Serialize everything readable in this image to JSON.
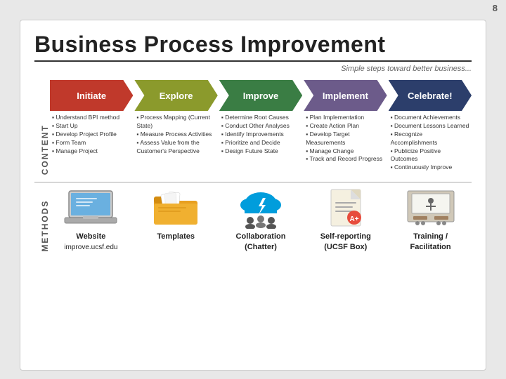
{
  "page": {
    "number": "8"
  },
  "header": {
    "title": "Business Process Improvement",
    "subtitle": "Simple steps toward better business..."
  },
  "labels": {
    "content": "CONTENT",
    "methods": "METHODS"
  },
  "arrows": [
    {
      "id": "initiate",
      "label": "Initiate",
      "color": "arrow-red"
    },
    {
      "id": "explore",
      "label": "Explore",
      "color": "arrow-olive"
    },
    {
      "id": "improve",
      "label": "Improve",
      "color": "arrow-green"
    },
    {
      "id": "implement",
      "label": "Implement",
      "color": "arrow-purple"
    },
    {
      "id": "celebrate",
      "label": "Celebrate!",
      "color": "arrow-darkblue"
    }
  ],
  "bullets": [
    {
      "items": [
        "Understand BPI method",
        "Start Up",
        "Develop Project Profile",
        "Form Team",
        "Manage Project"
      ]
    },
    {
      "items": [
        "Process Mapping (Current State)",
        "Measure Process Activities",
        "Assess Value from the Customer's Perspective"
      ]
    },
    {
      "items": [
        "Determine Root Causes",
        "Conduct Other Analyses",
        "Identify Improvements",
        "Prioritize and Decide",
        "Design Future State"
      ]
    },
    {
      "items": [
        "Plan Implementation",
        "Create Action Plan",
        "Develop Target Measurements",
        "Manage Change",
        "Track and Record Progress"
      ]
    },
    {
      "items": [
        "Document Achievements",
        "Document Lessons Learned",
        "Recognize Accomplishments",
        "Publicize Positive Outcomes",
        "Continuously Improve"
      ]
    }
  ],
  "methods": [
    {
      "id": "website",
      "label": "Website\nimprove.ucsf.edu",
      "icon": "laptop-icon"
    },
    {
      "id": "templates",
      "label": "Templates",
      "icon": "folder-icon"
    },
    {
      "id": "collaboration",
      "label": "Collaboration\n(Chatter)",
      "icon": "chatter-icon"
    },
    {
      "id": "self-reporting",
      "label": "Self-reporting\n(UCSF Box)",
      "icon": "report-icon"
    },
    {
      "id": "training",
      "label": "Training /\nFacilitation",
      "icon": "training-icon"
    }
  ]
}
